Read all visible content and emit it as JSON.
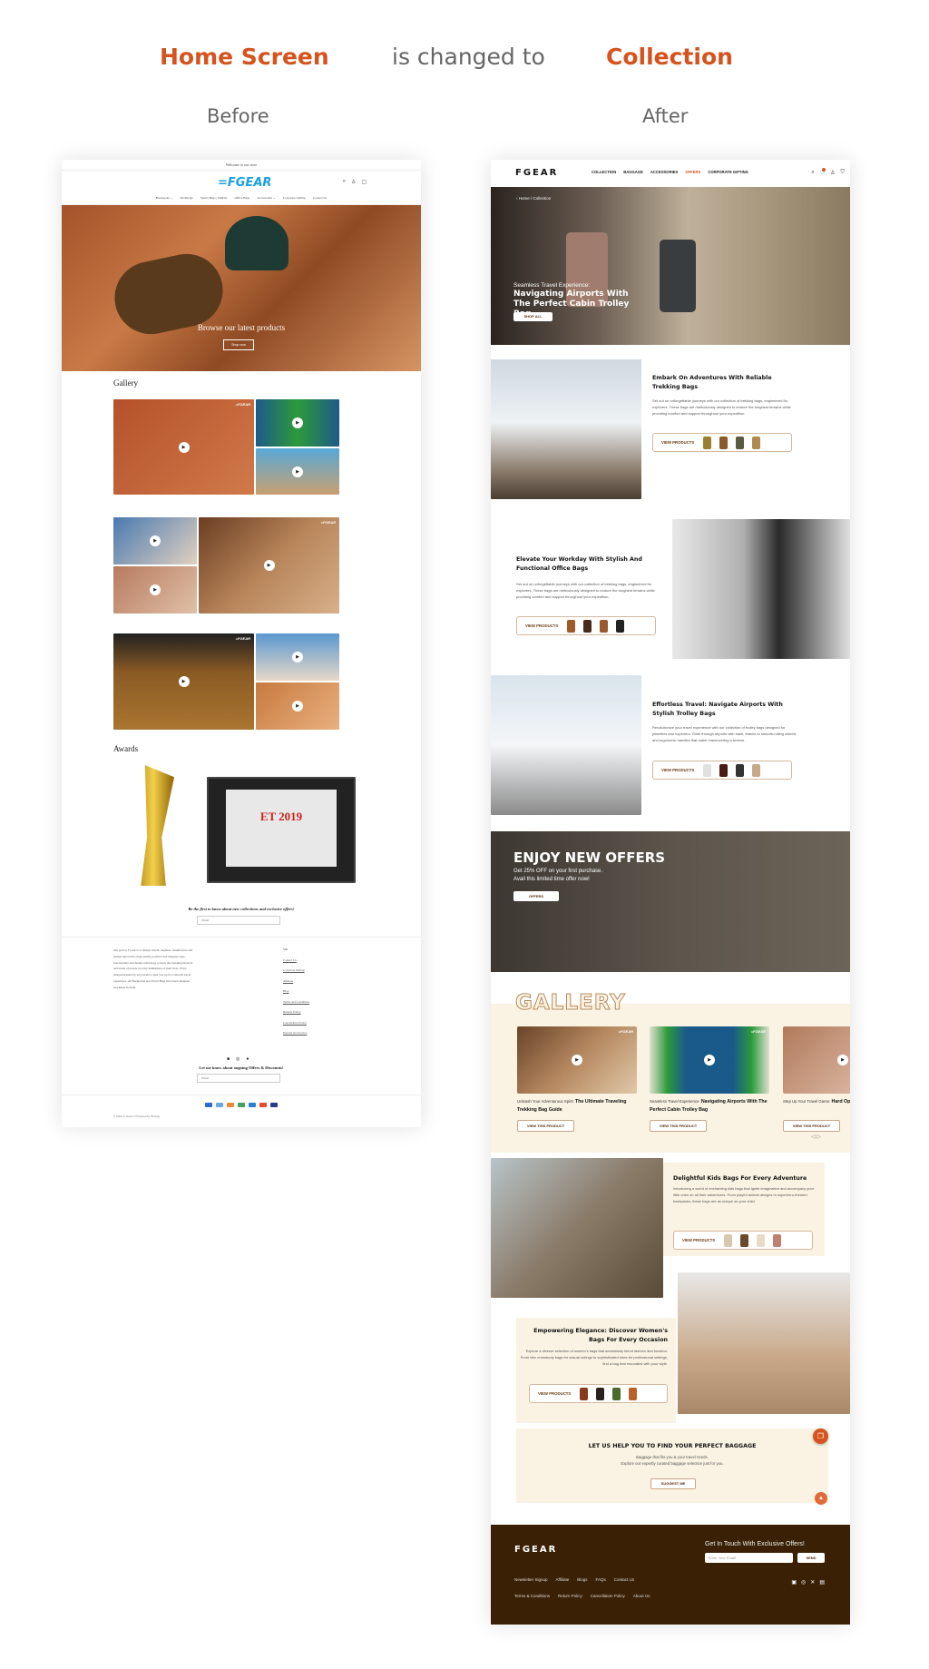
{
  "header": {
    "title_left": "Home Screen",
    "connector": "is changed to",
    "title_right": "Collection",
    "before_label": "Before",
    "after_label": "After"
  },
  "colors": {
    "accent": "#d4531e",
    "cream": "#faf3e3",
    "footer_brown": "#3a2106",
    "before_logo": "#1aa0e0"
  },
  "before": {
    "welcome": "Welcome to our store",
    "logo": "=FGEAR",
    "nav": [
      "Backpacks ⌄",
      "Strollbags",
      "Sports Bags | Duffels",
      "Office Bags",
      "Accessories ⌄",
      "Corporate Gifting",
      "Contact Us"
    ],
    "icons": [
      "search-icon",
      "account-icon",
      "cart-icon"
    ],
    "hero": {
      "title": "Browse our latest products",
      "button": "Shop now"
    },
    "gallery_title": "Gallery",
    "awards_title": "Awards",
    "certificate_text": "ET 2019",
    "newsletter": {
      "title": "Be the first to know about new collections and exclusive offers!",
      "placeholder": "Email"
    },
    "footer": {
      "about": "Our goal at F Gear is to design, invent, engineer, manufacture and market innovative, high quality products that integrate style, functionality and design technology to meet the changing lifestyle and needs of people in every hemisphere of their lives. Every design invented by us is made to gear you up for a smooth travel experience. All Backpacks and Travel Bags have been designed and Made In India.",
      "links_heading": "Site",
      "links": [
        "Contact Us",
        "Corporate Gifting",
        "Affiliate",
        "Blog",
        "Terms and Conditions",
        "Returns Policy",
        "Cancellation Policy",
        "Repairs and Service"
      ],
      "offers_text": "Let me know about ongoing Offers & Discounts!",
      "email_placeholder": "Email",
      "copyright": "© 2024, F Gear.in Powered by Shopify"
    }
  },
  "after": {
    "logo": "FGEAR",
    "nav": [
      "COLLECTION",
      "BAGGAGE",
      "ACCESSORIES",
      "OFFERS",
      "CORPORATE GIFTING"
    ],
    "breadcrumb": "Home / Collection",
    "hero": {
      "kicker": "Seamless Travel Experience:",
      "title": "Navigating Airports With The Perfect Cabin Trolley Bag",
      "button": "SHOP ALL"
    },
    "sections": [
      {
        "title": "Embark On Adventures With Reliable Trekking Bags",
        "text": "Set out on unforgettable journeys with our collection of trekking bags, engineered for explorers. These bags are meticulously designed to endure the toughest terrains while providing comfort and support throughout your expedition.",
        "button": "VIEW PRODUCTS"
      },
      {
        "title": "Elevate Your Workday With Stylish And Functional Office Bags",
        "text": "Set out on unforgettable journeys with our collection of trekking bags, engineered for explorers. These bags are meticulously designed to endure the toughest terrains while providing comfort and support throughout your expedition.",
        "button": "VIEW PRODUCTS"
      },
      {
        "title": "Effortless Travel: Navigate Airports With Stylish Trolley Bags",
        "text": "Revolutionize your travel experience with our collection of trolley bags designed for jetsetters and explorers. Glide through airports with ease, thanks to smooth-rolling wheels and ergonomic handles that make maneuvering a breeze.",
        "button": "VIEW PRODUCTS"
      }
    ],
    "offers": {
      "title": "ENJOY NEW OFFERS",
      "line1": "Get 25% OFF on your first purchase.",
      "line2": "Avail this limited time offer now!",
      "button": "OFFERS"
    },
    "gallery": {
      "title": "GALLERY",
      "cards": [
        {
          "kicker": "Unleash Your Adventurous Spirit: ",
          "title": "The Ultimate Traveling Trekking Bag Guide",
          "button": "VIEW THIS PRODUCT"
        },
        {
          "kicker": "Seamless Travel Experience: ",
          "title": "Navigating Airports With The Perfect Cabin Trolley Bag",
          "button": "VIEW THIS PRODUCT"
        },
        {
          "kicker": "Step Up Your Travel Game: ",
          "title": "Hard Options With You In Mind",
          "button": "VIEW THIS PRODUCT"
        }
      ]
    },
    "kids": {
      "title": "Delightful Kids Bags For Every Adventure",
      "text": "Introducing a world of enchanting kids bags that ignite imagination and accompany your little ones on all their adventures. From playful animal designs to superhero-themed backpacks, these bags are as unique as your child.",
      "button": "VIEW PRODUCTS"
    },
    "women": {
      "title": "Empowering Elegance: Discover Women's Bags For Every Occasion",
      "text": "Explore a diverse selection of women's bags that seamlessly blend fashion and function. From chic crossbody bags for casual outings to sophisticated totes for professional settings, find a bag that resonates with your style.",
      "button": "VIEW PRODUCTS"
    },
    "help": {
      "title": "LET US HELP YOU TO FIND YOUR PERFECT BAGGAGE",
      "line1": "Baggage that fits you & your travel needs.",
      "line2": "Explore our expertly curated baggage selection just for you.",
      "button": "SUGGEST ME"
    },
    "footer": {
      "logo": "FGEAR",
      "title": "Get In Touch With Exclusive Offers!",
      "email_placeholder": "Enter Your Email",
      "send": "SEND",
      "links_row1": [
        "Newsletter Signup",
        "Affiliate",
        "Blogs",
        "FAQs",
        "Contact Us"
      ],
      "links_row2": [
        "Terms & Conditions",
        "Return Policy",
        "Cancellation Policy",
        "About Us"
      ]
    }
  }
}
